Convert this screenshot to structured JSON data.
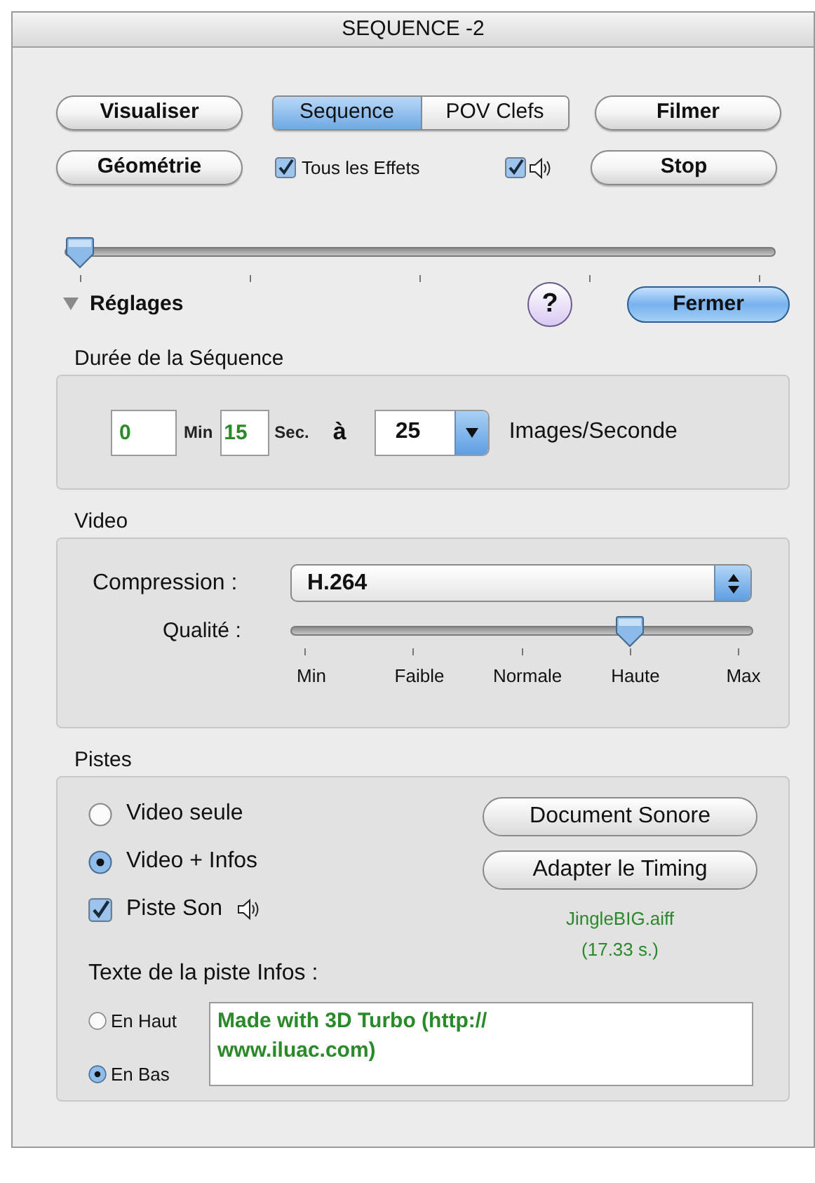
{
  "window": {
    "title": "SEQUENCE -2"
  },
  "toolbar": {
    "buttons_left": [
      "Visualiser",
      "Géométrie"
    ],
    "segments": [
      {
        "label": "Sequence",
        "selected": true
      },
      {
        "label": "POV Clefs",
        "selected": false
      }
    ],
    "effects_checkbox": {
      "label": "Tous les Effets",
      "checked": true
    },
    "sound_checkbox": {
      "checked": true
    },
    "buttons_right": [
      "Filmer",
      "Stop"
    ]
  },
  "timeline": {
    "level": 0
  },
  "settings": {
    "label": "Réglages",
    "expanded": true,
    "help": "?",
    "close_button": "Fermer"
  },
  "duration": {
    "title": "Durée de la Séquence",
    "minutes": "0",
    "minutes_unit": "Min",
    "seconds": "15",
    "seconds_unit": "Sec.",
    "at": "à",
    "fps": "25",
    "fps_unit": "Images/Seconde"
  },
  "video": {
    "title": "Video",
    "compression_label": "Compression :",
    "compression": "H.264",
    "quality_label": "Qualité :",
    "quality": {
      "level": 0.75
    },
    "quality_ticks": [
      "Min",
      "Faible",
      "Normale",
      "Haute",
      "Max"
    ]
  },
  "tracks": {
    "title": "Pistes",
    "modes": [
      {
        "label": "Video seule",
        "selected": false
      },
      {
        "label": "Video + Infos",
        "selected": true
      }
    ],
    "sound_track": {
      "label": "Piste Son",
      "checked": true
    },
    "buttons": [
      "Document Sonore",
      "Adapter le Timing"
    ],
    "sound_file": "JingleBIG.aiff",
    "sound_duration": "(17.33 s.)",
    "info_label": "Texte de la piste Infos :",
    "positions": [
      {
        "label": "En Haut",
        "selected": false
      },
      {
        "label": "En Bas",
        "selected": true
      }
    ],
    "info_text": "Made with 3D Turbo (http://\nwww.iluac.com)"
  }
}
